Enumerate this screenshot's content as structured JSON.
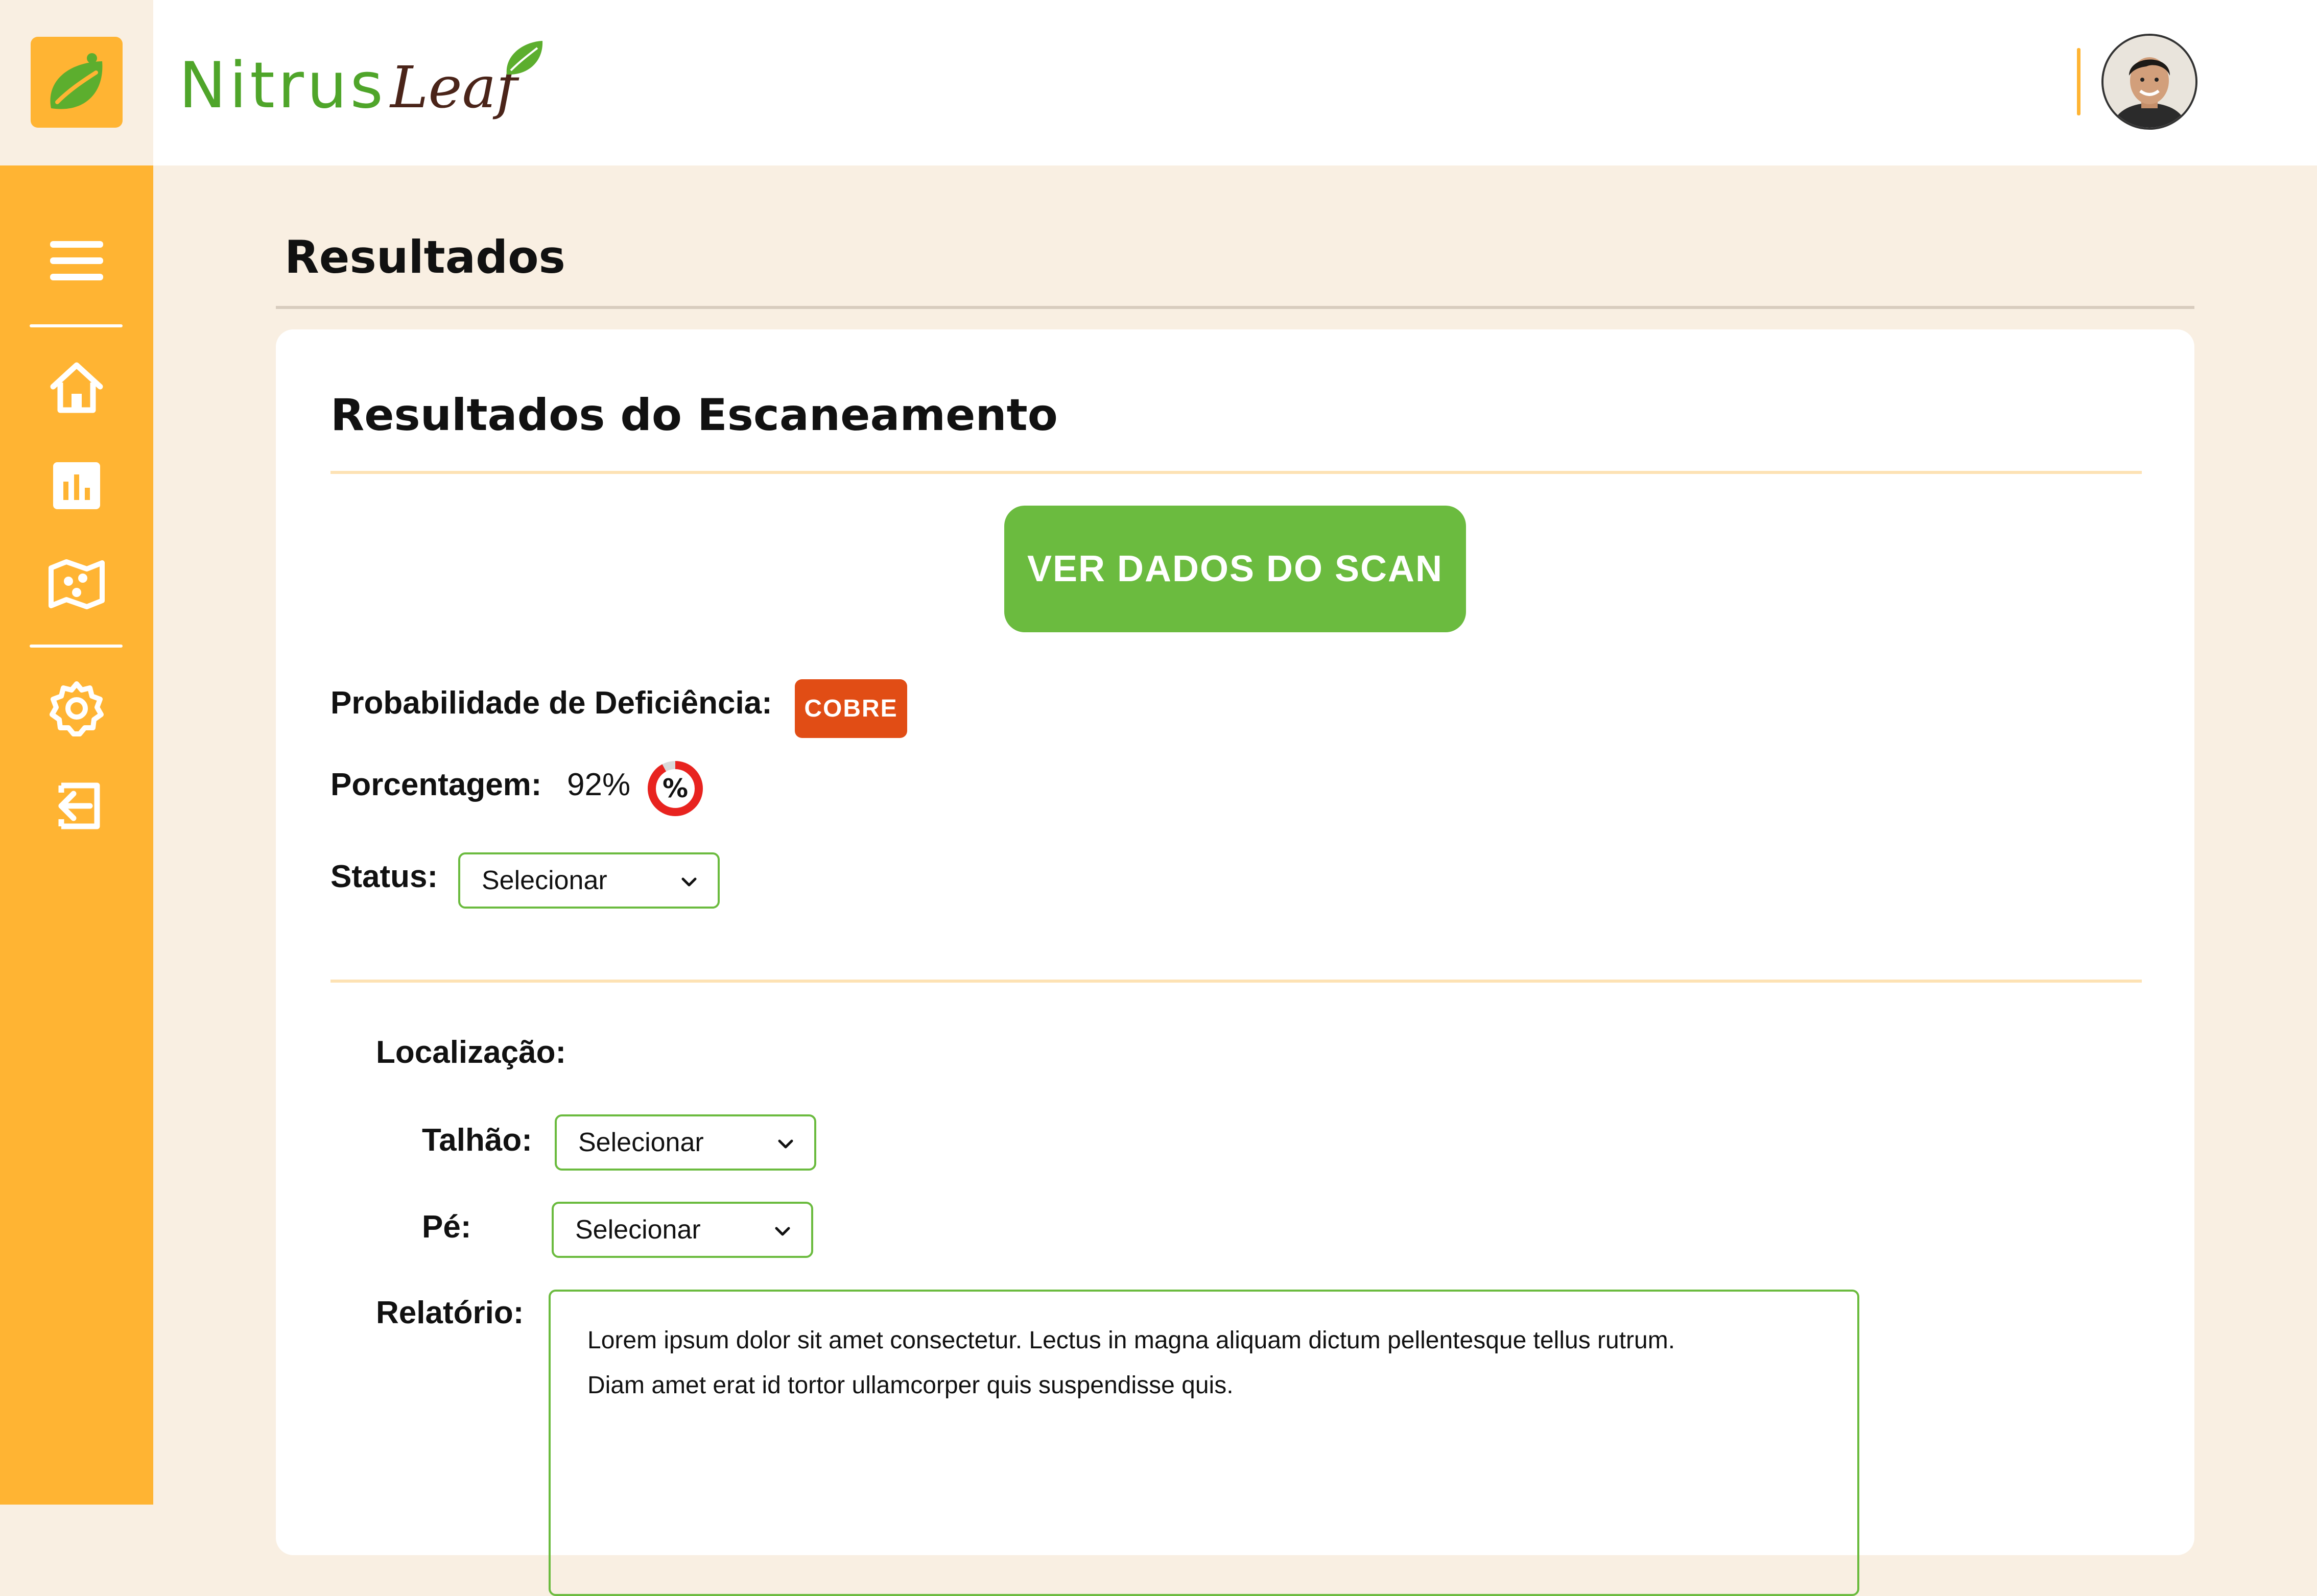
{
  "app": {
    "brand_name_part1": "Nitrus",
    "brand_name_part2": "Leaf",
    "accent_color": "#ffb433",
    "green_color": "#6bbb3f",
    "badge_color": "#e14d15"
  },
  "sidebar": {
    "items": [
      {
        "icon": "menu-icon"
      },
      {
        "icon": "home-icon"
      },
      {
        "icon": "chart-icon"
      },
      {
        "icon": "map-icon"
      },
      {
        "icon": "gear-icon"
      },
      {
        "icon": "logout-icon"
      }
    ]
  },
  "header": {
    "avatar_icon": "user-avatar"
  },
  "page": {
    "title": "Resultados"
  },
  "results": {
    "title": "Resultados do Escaneamento",
    "scan_button": "VER DADOS DO SCAN",
    "probability_label": "Probabilidade de Deficiência:",
    "deficiency_badge": "COBRE",
    "percentage_label": "Porcentagem:",
    "percentage_value": "92%",
    "percentage_fraction": 0.92,
    "percentage_icon_text": "%",
    "status_label": "Status:",
    "status_select": "Selecionar"
  },
  "location": {
    "label": "Localização:",
    "plot_label": "Talhão:",
    "plot_select": "Selecionar",
    "tree_label": "Pé:",
    "tree_select": "Selecionar"
  },
  "report": {
    "label": "Relatório:",
    "line1": "Lorem ipsum dolor sit amet consectetur. Lectus in magna aliquam dictum pellentesque tellus rutrum.",
    "line2": "Diam amet erat id tortor ullamcorper quis suspendisse quis."
  }
}
